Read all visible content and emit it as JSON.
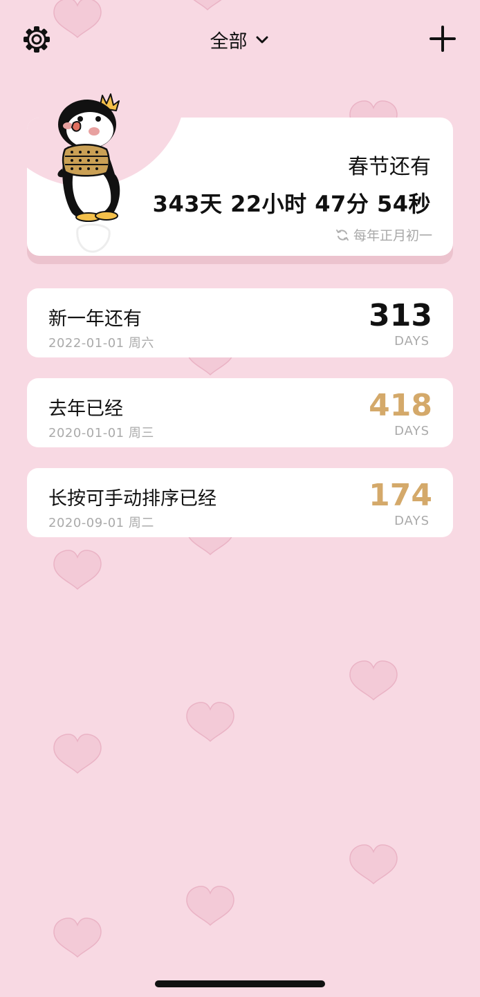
{
  "header": {
    "title": "全部",
    "settings_icon": "gear-icon",
    "dropdown_icon": "chevron-down-icon",
    "add_icon": "plus-icon"
  },
  "featured": {
    "label": "春节还有",
    "countdown": "343天 22小时 47分 54秒",
    "repeat_icon": "refresh-icon",
    "repeat_text": "每年正月初一"
  },
  "events": [
    {
      "title": "新一年还有",
      "date": "2022-01-01 周六",
      "count": "313",
      "unit": "DAYS",
      "color": "#111111"
    },
    {
      "title": "去年已经",
      "date": "2020-01-01 周三",
      "count": "418",
      "unit": "DAYS",
      "color": "#d4a96a"
    },
    {
      "title": "长按可手动排序已经",
      "date": "2020-09-01 周二",
      "count": "174",
      "unit": "DAYS",
      "color": "#d4a96a"
    }
  ],
  "colors": {
    "background": "#f8d9e3",
    "heart": "#f2c4d3",
    "card": "#ffffff",
    "past_accent": "#d4a96a"
  }
}
